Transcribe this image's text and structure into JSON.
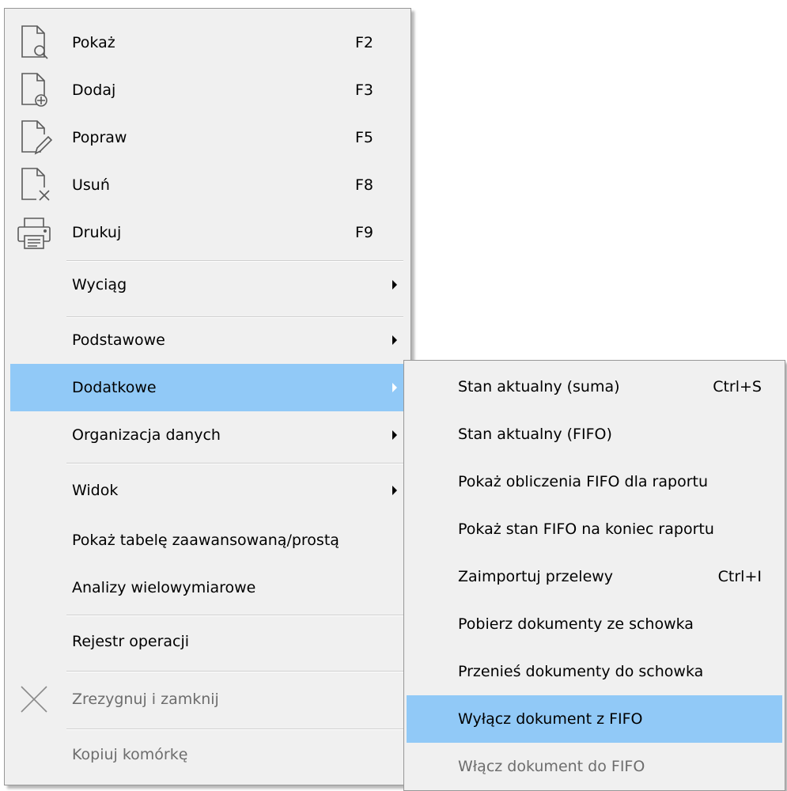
{
  "main_menu": {
    "items": [
      {
        "label": "Pokaż",
        "shortcut": "F2",
        "icon": "document-search-icon"
      },
      {
        "label": "Dodaj",
        "shortcut": "F3",
        "icon": "document-add-icon"
      },
      {
        "label": "Popraw",
        "shortcut": "F5",
        "icon": "document-edit-icon"
      },
      {
        "label": "Usuń",
        "shortcut": "F8",
        "icon": "document-delete-icon"
      },
      {
        "label": "Drukuj",
        "shortcut": "F9",
        "icon": "printer-icon"
      },
      {
        "label": "Wyciąg",
        "submenu": true
      },
      {
        "label": "Podstawowe",
        "submenu": true
      },
      {
        "label": "Dodatkowe",
        "submenu": true,
        "highlighted": true
      },
      {
        "label": "Organizacja danych",
        "submenu": true
      },
      {
        "label": "Widok",
        "submenu": true
      },
      {
        "label": "Pokaż tabelę zaawansowaną/prostą"
      },
      {
        "label": "Analizy wielowymiarowe"
      },
      {
        "label": "Rejestr operacji"
      },
      {
        "label": "Zrezygnuj i zamknij",
        "disabled": true,
        "icon": "close-x-icon"
      },
      {
        "label": "Kopiuj komórkę",
        "disabled": true
      }
    ]
  },
  "sub_menu": {
    "items": [
      {
        "label": "Stan aktualny (suma)",
        "shortcut": "Ctrl+S"
      },
      {
        "label": "Stan aktualny (FIFO)"
      },
      {
        "label": "Pokaż obliczenia FIFO dla raportu"
      },
      {
        "label": "Pokaż stan FIFO na koniec raportu"
      },
      {
        "label": "Zaimportuj przelewy",
        "shortcut": "Ctrl+I"
      },
      {
        "label": "Pobierz dokumenty ze schowka"
      },
      {
        "label": "Przenieś dokumenty do schowka"
      },
      {
        "label": "Wyłącz dokument z FIFO",
        "highlighted": true
      },
      {
        "label": "Włącz dokument do FIFO",
        "disabled": true
      }
    ]
  },
  "colors": {
    "menu_background": "#f0f0f0",
    "highlight": "#91c9f7",
    "disabled_text": "#6d6d6d"
  }
}
